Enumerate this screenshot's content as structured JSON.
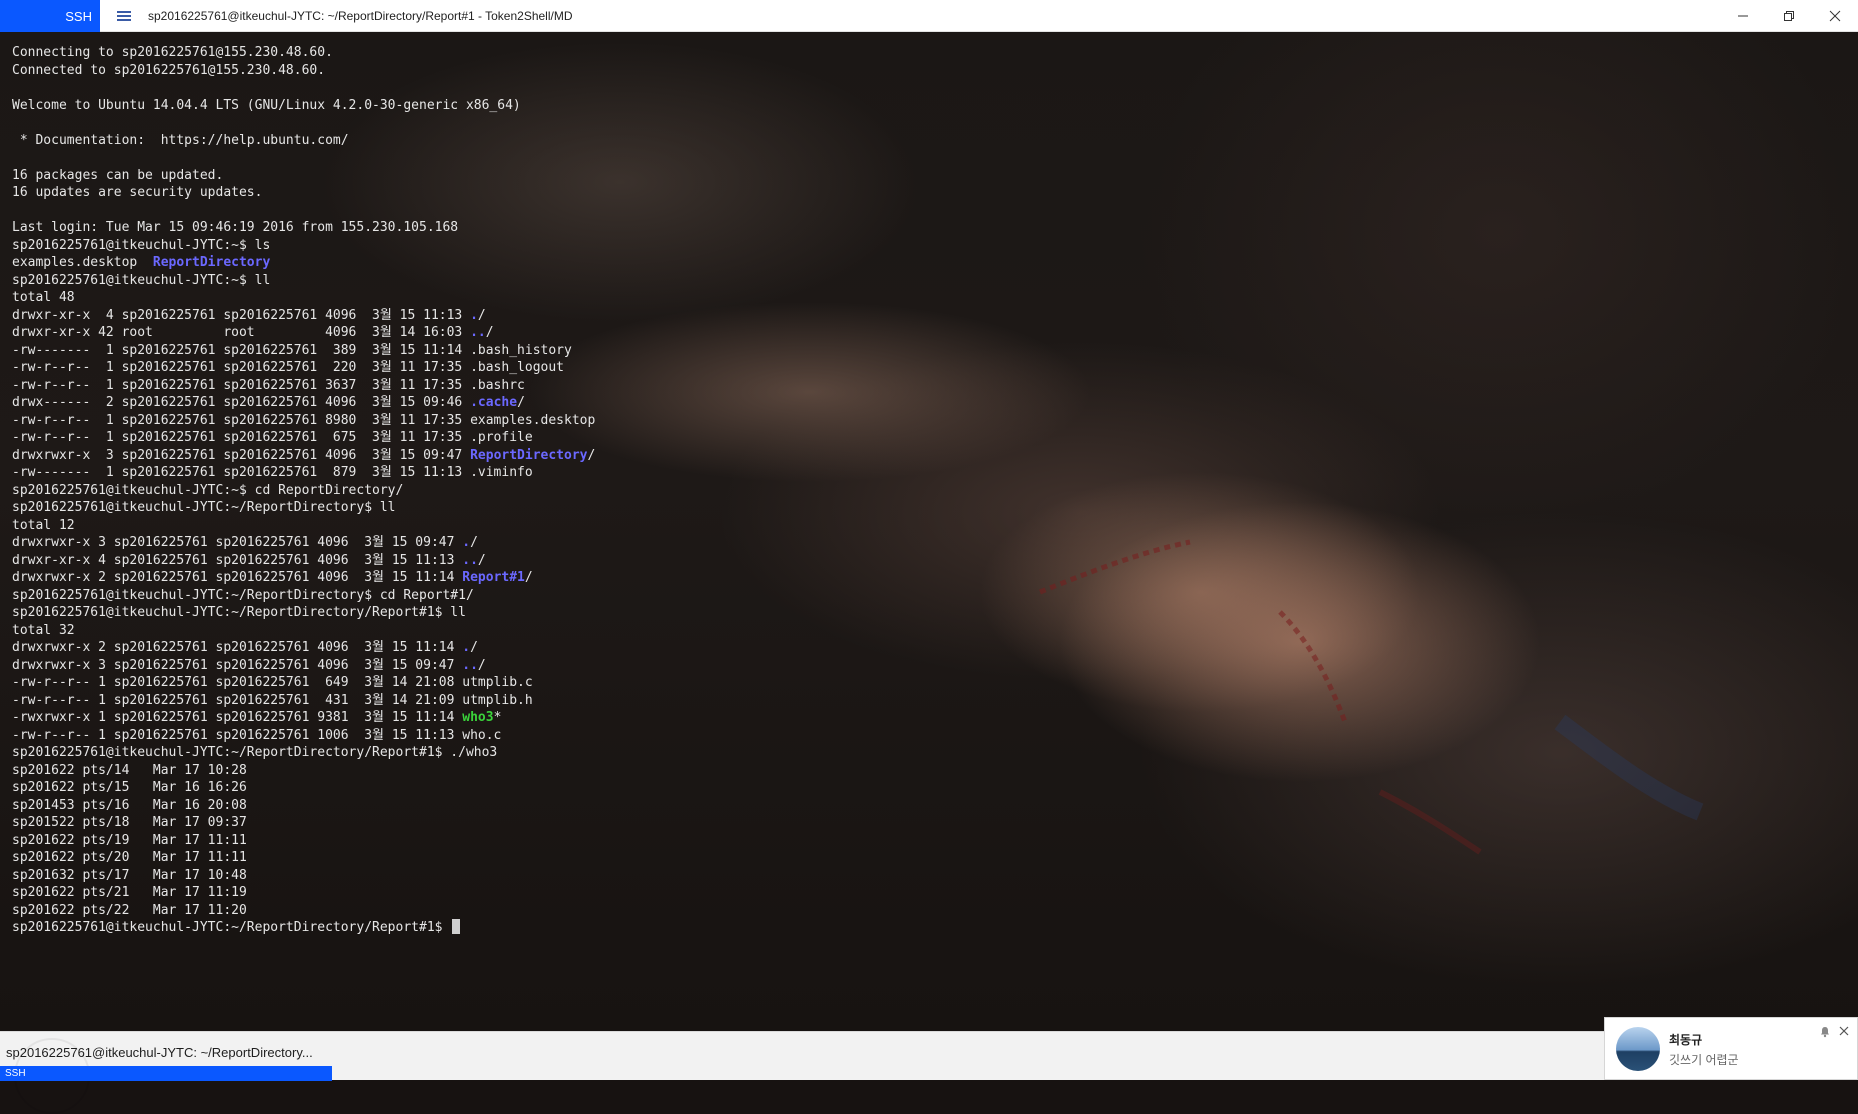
{
  "titlebar": {
    "ssh_label": "SSH",
    "window_title": "sp2016225761@itkeuchul-JYTC: ~/ReportDirectory/Report#1 - Token2Shell/MD",
    "accent_color": "#0a58ff"
  },
  "terminal": {
    "lines": [
      {
        "segments": [
          {
            "text": "Connecting to sp2016225761@155.230.48.60."
          }
        ]
      },
      {
        "segments": [
          {
            "text": "Connected to sp2016225761@155.230.48.60."
          }
        ]
      },
      {
        "segments": [
          {
            "text": ""
          }
        ]
      },
      {
        "segments": [
          {
            "text": "Welcome to Ubuntu 14.04.4 LTS (GNU/Linux 4.2.0-30-generic x86_64)"
          }
        ]
      },
      {
        "segments": [
          {
            "text": ""
          }
        ]
      },
      {
        "segments": [
          {
            "text": " * Documentation:  https://help.ubuntu.com/"
          }
        ]
      },
      {
        "segments": [
          {
            "text": ""
          }
        ]
      },
      {
        "segments": [
          {
            "text": "16 packages can be updated."
          }
        ]
      },
      {
        "segments": [
          {
            "text": "16 updates are security updates."
          }
        ]
      },
      {
        "segments": [
          {
            "text": ""
          }
        ]
      },
      {
        "segments": [
          {
            "text": "Last login: Tue Mar 15 09:46:19 2016 from 155.230.105.168"
          }
        ]
      },
      {
        "segments": [
          {
            "text": "sp2016225761@itkeuchul-JYTC:~$ ls"
          }
        ]
      },
      {
        "segments": [
          {
            "text": "examples.desktop  "
          },
          {
            "text": "ReportDirectory",
            "style": "blue"
          }
        ]
      },
      {
        "segments": [
          {
            "text": "sp2016225761@itkeuchul-JYTC:~$ ll"
          }
        ]
      },
      {
        "segments": [
          {
            "text": "total 48"
          }
        ]
      },
      {
        "segments": [
          {
            "text": "drwxr-xr-x  4 sp2016225761 sp2016225761 4096  3월 15 11:13 "
          },
          {
            "text": ".",
            "style": "blue"
          },
          {
            "text": "/"
          }
        ]
      },
      {
        "segments": [
          {
            "text": "drwxr-xr-x 42 root         root         4096  3월 14 16:03 "
          },
          {
            "text": "..",
            "style": "blue"
          },
          {
            "text": "/"
          }
        ]
      },
      {
        "segments": [
          {
            "text": "-rw-------  1 sp2016225761 sp2016225761  389  3월 15 11:14 .bash_history"
          }
        ]
      },
      {
        "segments": [
          {
            "text": "-rw-r--r--  1 sp2016225761 sp2016225761  220  3월 11 17:35 .bash_logout"
          }
        ]
      },
      {
        "segments": [
          {
            "text": "-rw-r--r--  1 sp2016225761 sp2016225761 3637  3월 11 17:35 .bashrc"
          }
        ]
      },
      {
        "segments": [
          {
            "text": "drwx------  2 sp2016225761 sp2016225761 4096  3월 15 09:46 "
          },
          {
            "text": ".cache",
            "style": "blue"
          },
          {
            "text": "/"
          }
        ]
      },
      {
        "segments": [
          {
            "text": "-rw-r--r--  1 sp2016225761 sp2016225761 8980  3월 11 17:35 examples.desktop"
          }
        ]
      },
      {
        "segments": [
          {
            "text": "-rw-r--r--  1 sp2016225761 sp2016225761  675  3월 11 17:35 .profile"
          }
        ]
      },
      {
        "segments": [
          {
            "text": "drwxrwxr-x  3 sp2016225761 sp2016225761 4096  3월 15 09:47 "
          },
          {
            "text": "ReportDirectory",
            "style": "blue"
          },
          {
            "text": "/"
          }
        ]
      },
      {
        "segments": [
          {
            "text": "-rw-------  1 sp2016225761 sp2016225761  879  3월 15 11:13 .viminfo"
          }
        ]
      },
      {
        "segments": [
          {
            "text": "sp2016225761@itkeuchul-JYTC:~$ cd ReportDirectory/"
          }
        ]
      },
      {
        "segments": [
          {
            "text": "sp2016225761@itkeuchul-JYTC:~/ReportDirectory$ ll"
          }
        ]
      },
      {
        "segments": [
          {
            "text": "total 12"
          }
        ]
      },
      {
        "segments": [
          {
            "text": "drwxrwxr-x 3 sp2016225761 sp2016225761 4096  3월 15 09:47 "
          },
          {
            "text": ".",
            "style": "blue"
          },
          {
            "text": "/"
          }
        ]
      },
      {
        "segments": [
          {
            "text": "drwxr-xr-x 4 sp2016225761 sp2016225761 4096  3월 15 11:13 "
          },
          {
            "text": "..",
            "style": "blue"
          },
          {
            "text": "/"
          }
        ]
      },
      {
        "segments": [
          {
            "text": "drwxrwxr-x 2 sp2016225761 sp2016225761 4096  3월 15 11:14 "
          },
          {
            "text": "Report#1",
            "style": "blue"
          },
          {
            "text": "/"
          }
        ]
      },
      {
        "segments": [
          {
            "text": "sp2016225761@itkeuchul-JYTC:~/ReportDirectory$ cd Report#1/"
          }
        ]
      },
      {
        "segments": [
          {
            "text": "sp2016225761@itkeuchul-JYTC:~/ReportDirectory/Report#1$ ll"
          }
        ]
      },
      {
        "segments": [
          {
            "text": "total 32"
          }
        ]
      },
      {
        "segments": [
          {
            "text": "drwxrwxr-x 2 sp2016225761 sp2016225761 4096  3월 15 11:14 "
          },
          {
            "text": ".",
            "style": "blue"
          },
          {
            "text": "/"
          }
        ]
      },
      {
        "segments": [
          {
            "text": "drwxrwxr-x 3 sp2016225761 sp2016225761 4096  3월 15 09:47 "
          },
          {
            "text": "..",
            "style": "blue"
          },
          {
            "text": "/"
          }
        ]
      },
      {
        "segments": [
          {
            "text": "-rw-r--r-- 1 sp2016225761 sp2016225761  649  3월 14 21:08 utmplib.c"
          }
        ]
      },
      {
        "segments": [
          {
            "text": "-rw-r--r-- 1 sp2016225761 sp2016225761  431  3월 14 21:09 utmplib.h"
          }
        ]
      },
      {
        "segments": [
          {
            "text": "-rwxrwxr-x 1 sp2016225761 sp2016225761 9381  3월 15 11:14 "
          },
          {
            "text": "who3",
            "style": "green"
          },
          {
            "text": "*"
          }
        ]
      },
      {
        "segments": [
          {
            "text": "-rw-r--r-- 1 sp2016225761 sp2016225761 1006  3월 15 11:13 who.c"
          }
        ]
      },
      {
        "segments": [
          {
            "text": "sp2016225761@itkeuchul-JYTC:~/ReportDirectory/Report#1$ ./who3"
          }
        ]
      },
      {
        "segments": [
          {
            "text": "sp201622 pts/14   Mar 17 10:28"
          }
        ]
      },
      {
        "segments": [
          {
            "text": "sp201622 pts/15   Mar 16 16:26"
          }
        ]
      },
      {
        "segments": [
          {
            "text": "sp201453 pts/16   Mar 16 20:08"
          }
        ]
      },
      {
        "segments": [
          {
            "text": "sp201522 pts/18   Mar 17 09:37"
          }
        ]
      },
      {
        "segments": [
          {
            "text": "sp201622 pts/19   Mar 17 11:11"
          }
        ]
      },
      {
        "segments": [
          {
            "text": "sp201622 pts/20   Mar 17 11:11"
          }
        ]
      },
      {
        "segments": [
          {
            "text": "sp201632 pts/17   Mar 17 10:48"
          }
        ]
      },
      {
        "segments": [
          {
            "text": "sp201622 pts/21   Mar 17 11:19"
          }
        ]
      },
      {
        "segments": [
          {
            "text": "sp201622 pts/22   Mar 17 11:20"
          }
        ]
      },
      {
        "segments": [
          {
            "text": "sp2016225761@itkeuchul-JYTC:~/ReportDirectory/Report#1$ "
          }
        ],
        "cursor": true
      }
    ],
    "colors": {
      "text": "#e6e6e6",
      "directory": "#6b68ff",
      "executable": "#3ad23a"
    }
  },
  "statusbar": {
    "session_label": "sp2016225761@itkeuchul-JYTC: ~/ReportDirectory...",
    "tab_label": "SSH"
  },
  "notification": {
    "sender": "최동규",
    "message": "깃쓰기 어렵군",
    "icons": [
      "bell-icon",
      "close-icon"
    ]
  }
}
